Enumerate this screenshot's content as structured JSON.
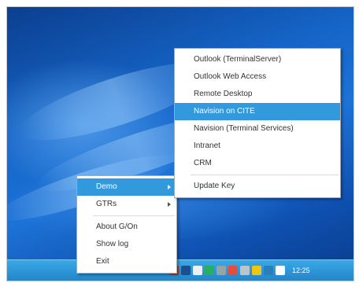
{
  "context_menu": {
    "items": [
      {
        "label": "Demo",
        "has_submenu": true,
        "selected": true
      },
      {
        "label": "GTRs",
        "has_submenu": true,
        "selected": false
      },
      {
        "label": "About G/On",
        "has_submenu": false,
        "selected": false
      },
      {
        "label": "Show log",
        "has_submenu": false,
        "selected": false
      },
      {
        "label": "Exit",
        "has_submenu": false,
        "selected": false
      }
    ]
  },
  "submenu": {
    "items": [
      {
        "label": "Outlook (TerminalServer)",
        "selected": false
      },
      {
        "label": "Outlook Web Access",
        "selected": false
      },
      {
        "label": "Remote Desktop",
        "selected": false
      },
      {
        "label": "Navision on CITE",
        "selected": true
      },
      {
        "label": "Navision (Terminal Services)",
        "selected": false
      },
      {
        "label": "Intranet",
        "selected": false
      },
      {
        "label": "CRM",
        "selected": false
      },
      {
        "label": "Update Key",
        "selected": false
      }
    ]
  },
  "taskbar": {
    "clock": "12:25",
    "tray_icons": [
      {
        "name": "gon-tray-icon",
        "color": "#c0392b"
      },
      {
        "name": "arrow-tray-icon",
        "color": "#1d4f8f"
      },
      {
        "name": "clock-tray-icon",
        "color": "#ecf0f1"
      },
      {
        "name": "green-tray-icon",
        "color": "#27ae60"
      },
      {
        "name": "network-tray-icon",
        "color": "#95a5a6"
      },
      {
        "name": "red-tray-icon",
        "color": "#e74c3c"
      },
      {
        "name": "monitor-tray-icon",
        "color": "#bdc3c7"
      },
      {
        "name": "volume-tray-icon",
        "color": "#f1c40f"
      },
      {
        "name": "shield-tray-icon",
        "color": "#2980b9"
      },
      {
        "name": "dot-tray-icon",
        "color": "#ffffff"
      }
    ]
  },
  "colors": {
    "selection": "#3399dd",
    "desktop": "#1565c8",
    "taskbar": "#2f97d9"
  }
}
